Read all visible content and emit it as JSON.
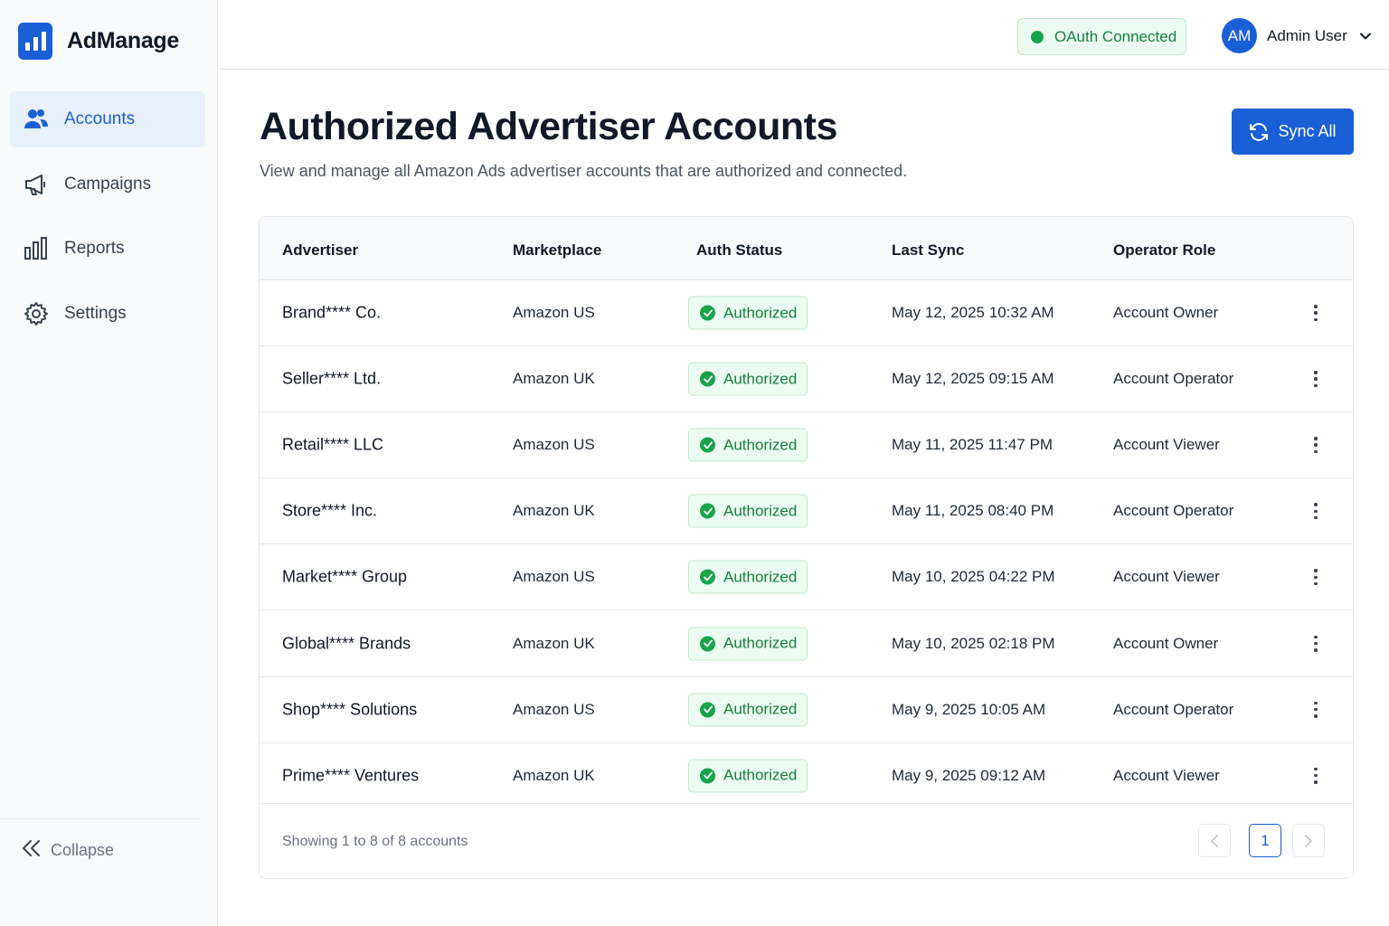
{
  "brand": {
    "name": "AdManage"
  },
  "sidebar": {
    "items": [
      {
        "label": "Accounts",
        "icon": "users-icon",
        "active": true
      },
      {
        "label": "Campaigns",
        "icon": "megaphone-icon",
        "active": false
      },
      {
        "label": "Reports",
        "icon": "bar-chart-icon",
        "active": false
      },
      {
        "label": "Settings",
        "icon": "gear-icon",
        "active": false
      }
    ],
    "collapse_label": "Collapse"
  },
  "header": {
    "oauth_status": "OAuth Connected",
    "user_initials": "AM",
    "user_name": "Admin User"
  },
  "main": {
    "title": "Authorized Advertiser Accounts",
    "subtitle": "View and manage all Amazon Ads advertiser accounts that are authorized and connected.",
    "sync_label": "Sync All"
  },
  "table": {
    "columns": [
      "Advertiser",
      "Marketplace",
      "Auth Status",
      "Last Sync",
      "Operator Role"
    ],
    "rows": [
      {
        "advertiser": "Brand**** Co.",
        "marketplace": "Amazon US",
        "status": "Authorized",
        "last_sync": "May 12, 2025 10:32 AM",
        "role": "Account Owner"
      },
      {
        "advertiser": "Seller**** Ltd.",
        "marketplace": "Amazon UK",
        "status": "Authorized",
        "last_sync": "May 12, 2025 09:15 AM",
        "role": "Account Operator"
      },
      {
        "advertiser": "Retail**** LLC",
        "marketplace": "Amazon US",
        "status": "Authorized",
        "last_sync": "May 11, 2025 11:47 PM",
        "role": "Account Viewer"
      },
      {
        "advertiser": "Store**** Inc.",
        "marketplace": "Amazon UK",
        "status": "Authorized",
        "last_sync": "May 11, 2025 08:40 PM",
        "role": "Account Operator"
      },
      {
        "advertiser": "Market**** Group",
        "marketplace": "Amazon US",
        "status": "Authorized",
        "last_sync": "May 10, 2025 04:22 PM",
        "role": "Account Viewer"
      },
      {
        "advertiser": "Global**** Brands",
        "marketplace": "Amazon UK",
        "status": "Authorized",
        "last_sync": "May 10, 2025 02:18 PM",
        "role": "Account Owner"
      },
      {
        "advertiser": "Shop**** Solutions",
        "marketplace": "Amazon US",
        "status": "Authorized",
        "last_sync": "May 9, 2025 10:05 AM",
        "role": "Account Operator"
      },
      {
        "advertiser": "Prime**** Ventures",
        "marketplace": "Amazon UK",
        "status": "Authorized",
        "last_sync": "May 9, 2025 09:12 AM",
        "role": "Account Viewer"
      }
    ],
    "footer_text": "Showing 1 to 8 of 8 accounts",
    "current_page": "1"
  },
  "colors": {
    "accent": "#1a5fd6",
    "success": "#16a34a",
    "success_bg": "#ecfbf1"
  }
}
